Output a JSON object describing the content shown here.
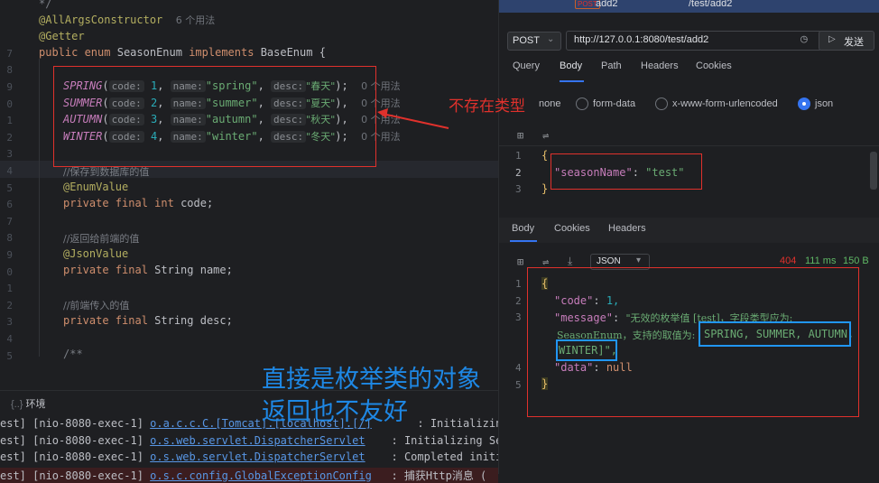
{
  "editor": {
    "lines": [
      {
        "no": "",
        "text": "*/"
      },
      {
        "no": "",
        "ann": "@AllArgsConstructor",
        "usage": "6 个用法"
      },
      {
        "no": "",
        "ann": "@Getter"
      },
      {
        "no": "7",
        "kw1": "public enum",
        "cls": "SeasonEnum",
        "kw2": "implements",
        "iface": "BaseEnum {"
      },
      {
        "no": "8"
      },
      {
        "no": "9"
      },
      {
        "no": "0"
      },
      {
        "no": "1"
      },
      {
        "no": "2"
      },
      {
        "no": "3"
      },
      {
        "no": "4"
      },
      {
        "no": "5"
      }
    ],
    "enum_rows": [
      {
        "name": "SPRING",
        "code": "1",
        "sname": "\"spring\"",
        "desc": "\"春天\"",
        "end": ");",
        "usage": "0 个用法"
      },
      {
        "name": "SUMMER",
        "code": "2",
        "sname": "\"summer\"",
        "desc": "\"夏天\"",
        "end": "),",
        "usage": "0 个用法"
      },
      {
        "name": "AUTUMN",
        "code": "3",
        "sname": "\"autumn\"",
        "desc": "\"秋天\"",
        "end": "),",
        "usage": "0 个用法"
      },
      {
        "name": "WINTER",
        "code": "4",
        "sname": "\"winter\"",
        "desc": "\"冬天\"",
        "end": ");",
        "usage": "0 个用法"
      }
    ],
    "hints": {
      "code": "code:",
      "name": "name:",
      "desc": "desc:"
    },
    "comment1": "//保存到数据库的值",
    "ann_enumvalue": "@EnumValue",
    "field1": "private final int code;",
    "comment2": "//返回给前端的值",
    "ann_jsonvalue": "@JsonValue",
    "field2": "private final String name;",
    "comment3": "//前端传入的值",
    "field3": "private final String desc;",
    "doc_start": "/**",
    "line_numbers": [
      "",
      "",
      "",
      "7",
      "8",
      "9",
      "0",
      "1",
      "2",
      "3",
      "4",
      "5",
      "6",
      "7",
      "8",
      "9",
      "0",
      "1",
      "2",
      "3",
      "4",
      "5"
    ]
  },
  "bottom": {
    "tab_label": "环境",
    "logs": [
      {
        "a": "est] [nio-8080-exec-1] ",
        "cls": "o.a.c.c.C.[Tomcat].[localhost].[/]",
        "msg": "       : Initializing Spri"
      },
      {
        "a": "est] [nio-8080-exec-1] ",
        "cls": "o.s.web.servlet.DispatcherServlet",
        "msg": "    : Initializing Serv"
      },
      {
        "a": "est] [nio-8080-exec-1] ",
        "cls": "o.s.web.servlet.DispatcherServlet",
        "msg": "    : Completed initial"
      },
      {
        "a": "est] [nio-8080-exec-1] ",
        "cls": "o.s.c.config.GlobalExceptionConfig",
        "msg": "   : 捕获Http消息 ("
      }
    ]
  },
  "right": {
    "top_item": {
      "method_badge": "POST",
      "name": "add2",
      "path": "/test/add2"
    },
    "method": "POST",
    "url": "http://127.0.0.1:8080/test/add2",
    "send_label": "发送",
    "req_tabs": [
      "Query",
      "Body",
      "Path",
      "Headers",
      "Cookies"
    ],
    "body_types": [
      "none",
      "form-data",
      "x-www-form-urlencoded",
      "json"
    ],
    "selected_type": "json",
    "req_body": {
      "lines": [
        "{",
        "\"seasonName\": \"test\"",
        "}"
      ],
      "line_nos": [
        "1",
        "2",
        "3"
      ]
    },
    "resp_tabs": [
      "Body",
      "Cookies",
      "Headers"
    ],
    "resp_format": "JSON",
    "status": {
      "code": "404",
      "time": "111 ms",
      "size": "150 B"
    },
    "resp_body": {
      "line_nos": [
        "1",
        "2",
        "3",
        "4",
        "5"
      ],
      "open": "{",
      "code_key": "\"code\"",
      "code_val": "1,",
      "message_key": "\"message\"",
      "message_part1": "\"无效的枚举值 [test]，字段类型应为:",
      "message_part2": "SeasonEnum，支持的取值为:",
      "message_part3": "SPRING, SUMMER, AUTUMN,",
      "message_part4": "WINTER]\",",
      "data_key": "\"data\"",
      "data_val": "null",
      "close": "}"
    }
  },
  "annotations": {
    "not_exist_type": "不存在类型",
    "big_text_line1": "直接是枚举类的对象",
    "big_text_line2": "返回也不友好"
  },
  "colors": {
    "red_mark": "#e0312c",
    "blue_mark": "#2196f3",
    "accent": "#3574f0"
  }
}
